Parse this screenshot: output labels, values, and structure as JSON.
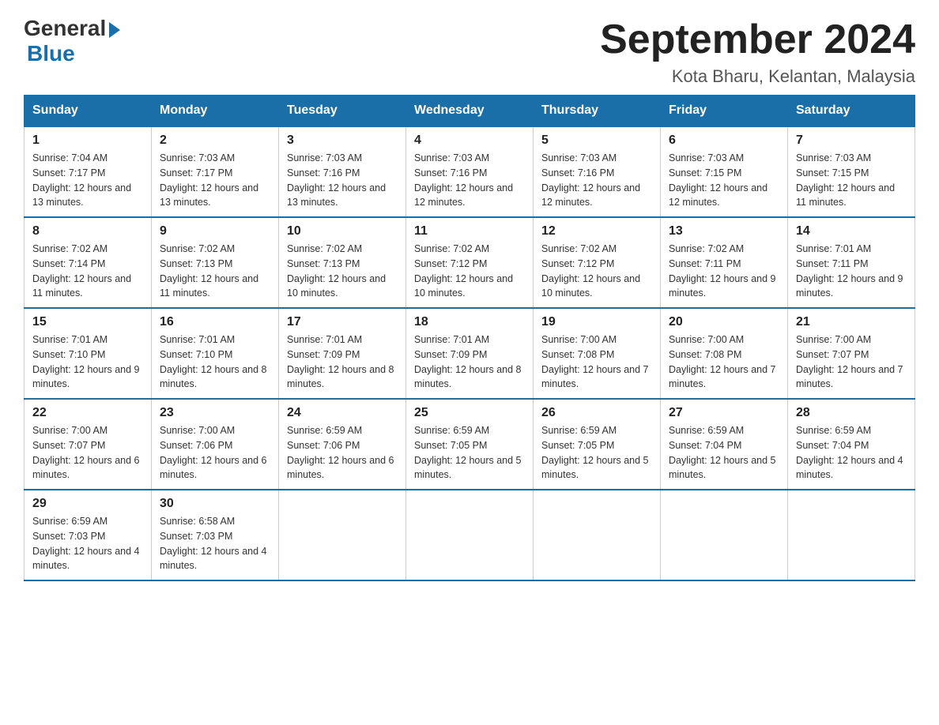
{
  "header": {
    "logo_text_general": "General",
    "logo_text_blue": "Blue",
    "title": "September 2024",
    "subtitle": "Kota Bharu, Kelantan, Malaysia"
  },
  "days_of_week": [
    "Sunday",
    "Monday",
    "Tuesday",
    "Wednesday",
    "Thursday",
    "Friday",
    "Saturday"
  ],
  "weeks": [
    [
      {
        "num": "1",
        "sunrise": "Sunrise: 7:04 AM",
        "sunset": "Sunset: 7:17 PM",
        "daylight": "Daylight: 12 hours and 13 minutes."
      },
      {
        "num": "2",
        "sunrise": "Sunrise: 7:03 AM",
        "sunset": "Sunset: 7:17 PM",
        "daylight": "Daylight: 12 hours and 13 minutes."
      },
      {
        "num": "3",
        "sunrise": "Sunrise: 7:03 AM",
        "sunset": "Sunset: 7:16 PM",
        "daylight": "Daylight: 12 hours and 13 minutes."
      },
      {
        "num": "4",
        "sunrise": "Sunrise: 7:03 AM",
        "sunset": "Sunset: 7:16 PM",
        "daylight": "Daylight: 12 hours and 12 minutes."
      },
      {
        "num": "5",
        "sunrise": "Sunrise: 7:03 AM",
        "sunset": "Sunset: 7:16 PM",
        "daylight": "Daylight: 12 hours and 12 minutes."
      },
      {
        "num": "6",
        "sunrise": "Sunrise: 7:03 AM",
        "sunset": "Sunset: 7:15 PM",
        "daylight": "Daylight: 12 hours and 12 minutes."
      },
      {
        "num": "7",
        "sunrise": "Sunrise: 7:03 AM",
        "sunset": "Sunset: 7:15 PM",
        "daylight": "Daylight: 12 hours and 11 minutes."
      }
    ],
    [
      {
        "num": "8",
        "sunrise": "Sunrise: 7:02 AM",
        "sunset": "Sunset: 7:14 PM",
        "daylight": "Daylight: 12 hours and 11 minutes."
      },
      {
        "num": "9",
        "sunrise": "Sunrise: 7:02 AM",
        "sunset": "Sunset: 7:13 PM",
        "daylight": "Daylight: 12 hours and 11 minutes."
      },
      {
        "num": "10",
        "sunrise": "Sunrise: 7:02 AM",
        "sunset": "Sunset: 7:13 PM",
        "daylight": "Daylight: 12 hours and 10 minutes."
      },
      {
        "num": "11",
        "sunrise": "Sunrise: 7:02 AM",
        "sunset": "Sunset: 7:12 PM",
        "daylight": "Daylight: 12 hours and 10 minutes."
      },
      {
        "num": "12",
        "sunrise": "Sunrise: 7:02 AM",
        "sunset": "Sunset: 7:12 PM",
        "daylight": "Daylight: 12 hours and 10 minutes."
      },
      {
        "num": "13",
        "sunrise": "Sunrise: 7:02 AM",
        "sunset": "Sunset: 7:11 PM",
        "daylight": "Daylight: 12 hours and 9 minutes."
      },
      {
        "num": "14",
        "sunrise": "Sunrise: 7:01 AM",
        "sunset": "Sunset: 7:11 PM",
        "daylight": "Daylight: 12 hours and 9 minutes."
      }
    ],
    [
      {
        "num": "15",
        "sunrise": "Sunrise: 7:01 AM",
        "sunset": "Sunset: 7:10 PM",
        "daylight": "Daylight: 12 hours and 9 minutes."
      },
      {
        "num": "16",
        "sunrise": "Sunrise: 7:01 AM",
        "sunset": "Sunset: 7:10 PM",
        "daylight": "Daylight: 12 hours and 8 minutes."
      },
      {
        "num": "17",
        "sunrise": "Sunrise: 7:01 AM",
        "sunset": "Sunset: 7:09 PM",
        "daylight": "Daylight: 12 hours and 8 minutes."
      },
      {
        "num": "18",
        "sunrise": "Sunrise: 7:01 AM",
        "sunset": "Sunset: 7:09 PM",
        "daylight": "Daylight: 12 hours and 8 minutes."
      },
      {
        "num": "19",
        "sunrise": "Sunrise: 7:00 AM",
        "sunset": "Sunset: 7:08 PM",
        "daylight": "Daylight: 12 hours and 7 minutes."
      },
      {
        "num": "20",
        "sunrise": "Sunrise: 7:00 AM",
        "sunset": "Sunset: 7:08 PM",
        "daylight": "Daylight: 12 hours and 7 minutes."
      },
      {
        "num": "21",
        "sunrise": "Sunrise: 7:00 AM",
        "sunset": "Sunset: 7:07 PM",
        "daylight": "Daylight: 12 hours and 7 minutes."
      }
    ],
    [
      {
        "num": "22",
        "sunrise": "Sunrise: 7:00 AM",
        "sunset": "Sunset: 7:07 PM",
        "daylight": "Daylight: 12 hours and 6 minutes."
      },
      {
        "num": "23",
        "sunrise": "Sunrise: 7:00 AM",
        "sunset": "Sunset: 7:06 PM",
        "daylight": "Daylight: 12 hours and 6 minutes."
      },
      {
        "num": "24",
        "sunrise": "Sunrise: 6:59 AM",
        "sunset": "Sunset: 7:06 PM",
        "daylight": "Daylight: 12 hours and 6 minutes."
      },
      {
        "num": "25",
        "sunrise": "Sunrise: 6:59 AM",
        "sunset": "Sunset: 7:05 PM",
        "daylight": "Daylight: 12 hours and 5 minutes."
      },
      {
        "num": "26",
        "sunrise": "Sunrise: 6:59 AM",
        "sunset": "Sunset: 7:05 PM",
        "daylight": "Daylight: 12 hours and 5 minutes."
      },
      {
        "num": "27",
        "sunrise": "Sunrise: 6:59 AM",
        "sunset": "Sunset: 7:04 PM",
        "daylight": "Daylight: 12 hours and 5 minutes."
      },
      {
        "num": "28",
        "sunrise": "Sunrise: 6:59 AM",
        "sunset": "Sunset: 7:04 PM",
        "daylight": "Daylight: 12 hours and 4 minutes."
      }
    ],
    [
      {
        "num": "29",
        "sunrise": "Sunrise: 6:59 AM",
        "sunset": "Sunset: 7:03 PM",
        "daylight": "Daylight: 12 hours and 4 minutes."
      },
      {
        "num": "30",
        "sunrise": "Sunrise: 6:58 AM",
        "sunset": "Sunset: 7:03 PM",
        "daylight": "Daylight: 12 hours and 4 minutes."
      },
      null,
      null,
      null,
      null,
      null
    ]
  ]
}
